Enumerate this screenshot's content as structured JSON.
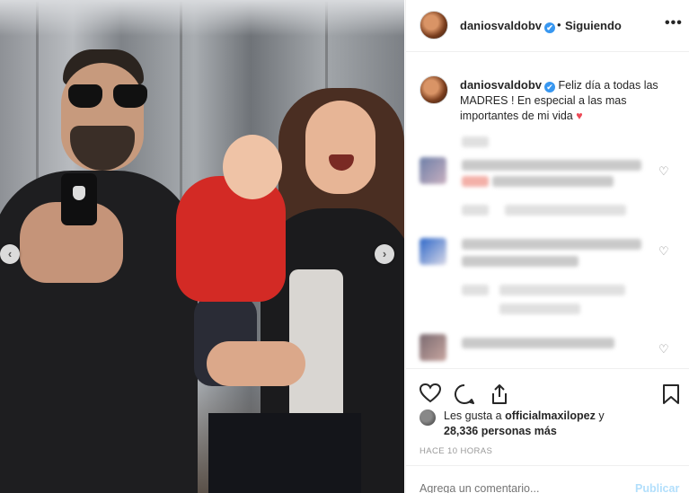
{
  "post": {
    "username": "daniosvaldobv",
    "verified_mark": "✔",
    "follow_status": "Siguiendo",
    "more_label": "•••",
    "caption": "Feliz día a todas las MADRES ! En especial a las mas importantes de mi vida",
    "caption_heart": "♥",
    "likes_prefix": "Les gusta a",
    "likes_user": "officialmaxilopez",
    "likes_conjunction": "y",
    "likes_count": "28,336 personas más",
    "timestamp": "HACE 10 HORAS",
    "comment_placeholder": "Agrega un comentario...",
    "publish_label": "Publicar"
  },
  "nav": {
    "prev": "‹",
    "next": "›"
  },
  "icons": {
    "like": "like-icon",
    "comment": "comment-icon",
    "share": "share-icon",
    "save": "bookmark-icon"
  },
  "colors": {
    "verified": "#3897f0",
    "heart": "#ed4956",
    "publish": "#b2dffc"
  }
}
